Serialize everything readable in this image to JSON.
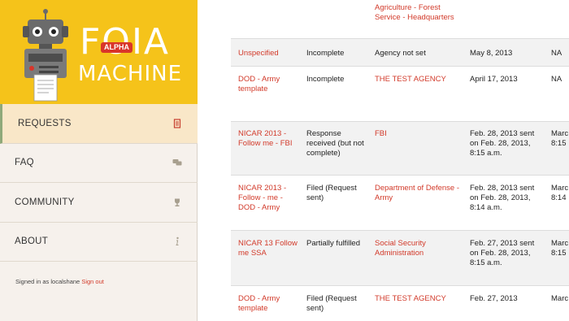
{
  "logo": {
    "title": "FOIA",
    "subtitle": "MACHINE",
    "badge": "ALPHA"
  },
  "nav": {
    "items": [
      {
        "label": "REQUESTS",
        "icon": "document-icon",
        "active": true
      },
      {
        "label": "FAQ",
        "icon": "chat-bubbles-icon",
        "active": false
      },
      {
        "label": "COMMUNITY",
        "icon": "trophy-icon",
        "active": false
      },
      {
        "label": "ABOUT",
        "icon": "info-icon",
        "active": false
      }
    ]
  },
  "user": {
    "signed_in_prefix": "Signed in as localshane",
    "sign_out": "Sign out"
  },
  "requests": {
    "rows": [
      {
        "title": "",
        "status": "",
        "agency": "Agriculture - Forest Service - Headquarters",
        "date": "",
        "last": ""
      },
      {
        "title": "Unspecified",
        "status": "Incomplete",
        "agency": "Agency not set",
        "agency_is_link": false,
        "date": "May 8, 2013",
        "last": "NA"
      },
      {
        "title": "DOD - Army template",
        "status": "Incomplete",
        "agency": "THE TEST AGENCY",
        "agency_is_link": true,
        "date": "April 17, 2013",
        "last": "NA"
      },
      {
        "title": "NICAR 2013 - Follow me - FBI",
        "status": "Response received (but not complete)",
        "agency": "FBI",
        "agency_is_link": true,
        "date": "Feb. 28, 2013 sent on Feb. 28, 2013, 8:15 a.m.",
        "last": "Marc 8:15"
      },
      {
        "title": "NICAR 2013 - Follow - me - DOD - Army",
        "status": "Filed (Request sent)",
        "agency": "Department of Defense - Army",
        "agency_is_link": true,
        "date": "Feb. 28, 2013 sent on Feb. 28, 2013, 8:14 a.m.",
        "last": "Marc 8:14"
      },
      {
        "title": "NICAR 13 Follow me SSA",
        "status": "Partially fulfilled",
        "agency": "Social Security Administration",
        "agency_is_link": true,
        "date": "Feb. 27, 2013 sent on Feb. 28, 2013, 8:15 a.m.",
        "last": "Marc 8:15"
      },
      {
        "title": "DOD - Army template",
        "status": "Filed (Request sent)",
        "agency": "THE TEST AGENCY",
        "agency_is_link": true,
        "date": "Feb. 27, 2013",
        "last": "Marc"
      }
    ]
  },
  "colors": {
    "accent": "#d23a2a",
    "logo_bg": "#f5c31a",
    "sidebar_bg": "#f6f1ec",
    "active_bg": "#f9e7c8"
  }
}
